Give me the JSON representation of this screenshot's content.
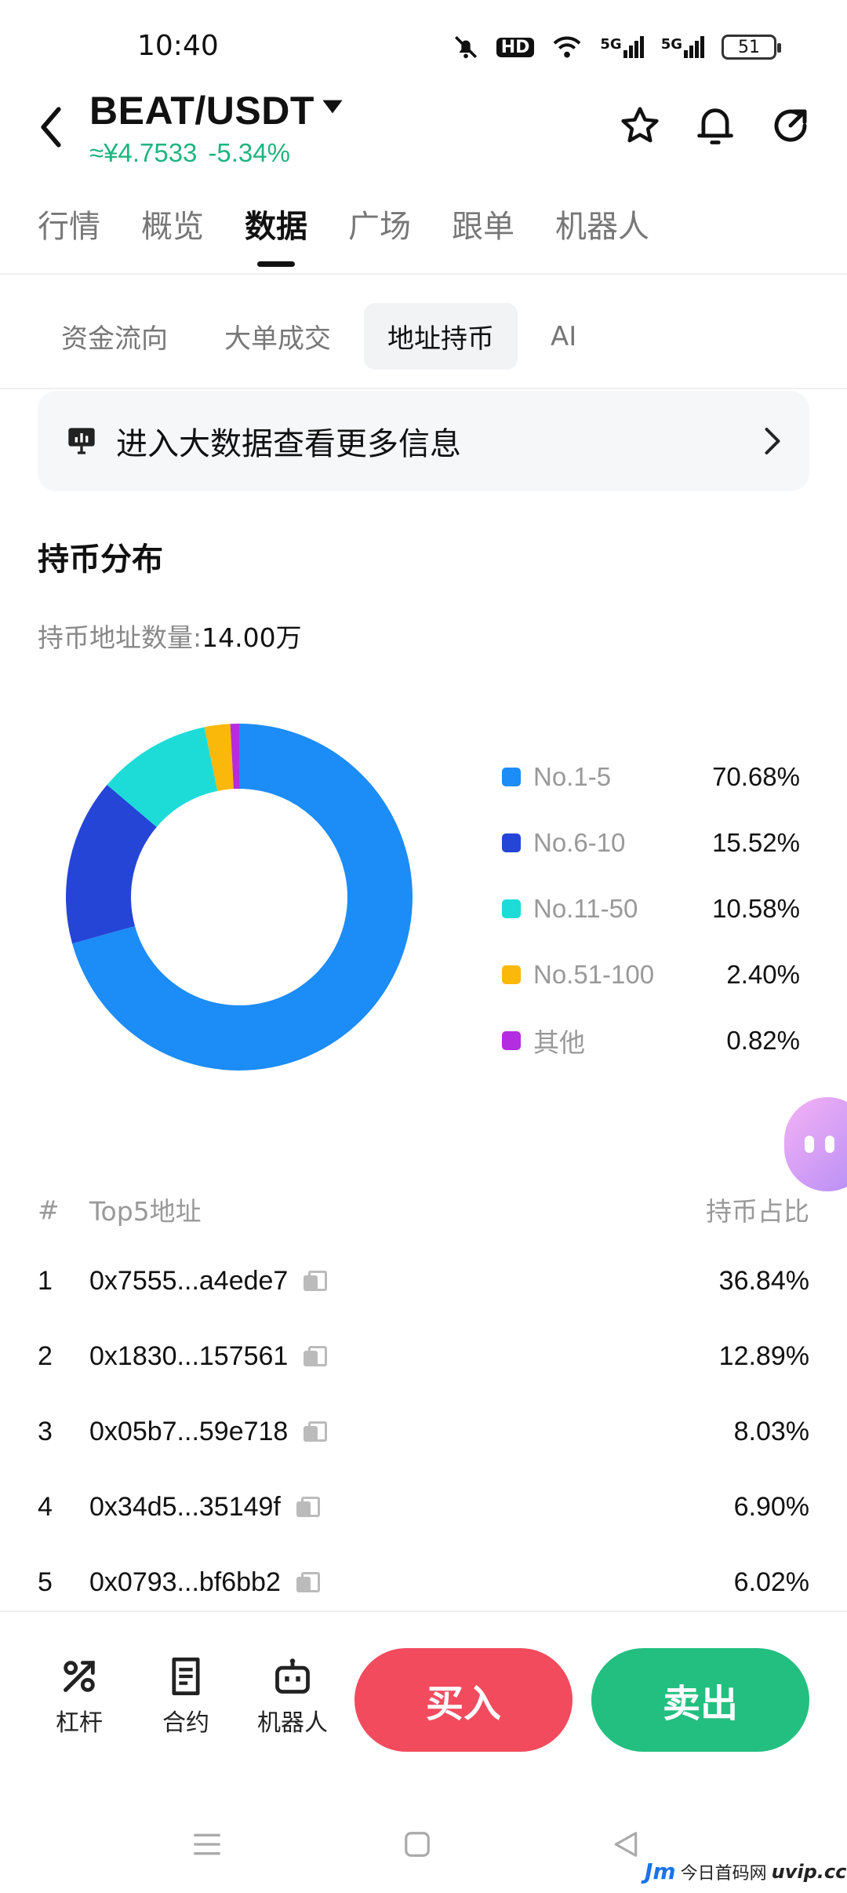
{
  "status_bar": {
    "time": "10:40",
    "hd": "HD",
    "net1": "5G",
    "net2": "5G",
    "battery": "51"
  },
  "header": {
    "pair": "BEAT/USDT",
    "price_cny": "≈¥4.7533",
    "change": "-5.34%",
    "change_color": "#1fb57f",
    "icons": [
      "back-arrow-icon",
      "star-icon",
      "bell-icon",
      "share-icon"
    ]
  },
  "main_tabs": [
    {
      "label": "行情",
      "active": false
    },
    {
      "label": "概览",
      "active": false
    },
    {
      "label": "数据",
      "active": true
    },
    {
      "label": "广场",
      "active": false
    },
    {
      "label": "跟单",
      "active": false
    },
    {
      "label": "机器人",
      "active": false
    }
  ],
  "sub_tabs": [
    {
      "label": "资金流向",
      "active": false
    },
    {
      "label": "大单成交",
      "active": false
    },
    {
      "label": "地址持币",
      "active": true
    },
    {
      "label": "AI",
      "active": false
    }
  ],
  "banner": {
    "text": "进入大数据查看更多信息"
  },
  "distribution": {
    "title": "持币分布",
    "holders_label": "持币地址数量:",
    "holders_value": "14.00万"
  },
  "chart_data": {
    "type": "pie",
    "donut": true,
    "categories": [
      "No.1-5",
      "No.6-10",
      "No.11-50",
      "No.51-100",
      "其他"
    ],
    "values": [
      70.68,
      15.52,
      10.58,
      2.4,
      0.82
    ],
    "labels": [
      "70.68%",
      "15.52%",
      "10.58%",
      "2.40%",
      "0.82%"
    ],
    "colors": [
      "#1c8cf7",
      "#2445d6",
      "#1ddcd8",
      "#f9b80a",
      "#b22ee0"
    ],
    "legend_position": "right"
  },
  "top5": {
    "col_num": "#",
    "col_addr": "Top5地址",
    "col_pct": "持币占比",
    "rows": [
      {
        "rank": "1",
        "address": "0x7555...a4ede7",
        "pct": "36.84%"
      },
      {
        "rank": "2",
        "address": "0x1830...157561",
        "pct": "12.89%"
      },
      {
        "rank": "3",
        "address": "0x05b7...59e718",
        "pct": "8.03%"
      },
      {
        "rank": "4",
        "address": "0x34d5...35149f",
        "pct": "6.90%"
      },
      {
        "rank": "5",
        "address": "0x0793...bf6bb2",
        "pct": "6.02%"
      }
    ]
  },
  "bottom": {
    "tools": [
      {
        "label": "杠杆",
        "icon": "leverage-icon"
      },
      {
        "label": "合约",
        "icon": "contract-icon"
      },
      {
        "label": "机器人",
        "icon": "robot-icon"
      }
    ],
    "buy": "买入",
    "sell": "卖出",
    "buy_color": "#f24b5e",
    "sell_color": "#23bf80"
  },
  "watermark": {
    "logo": "Jm",
    "text": "今日首码网",
    "url": "uvip.cc"
  }
}
